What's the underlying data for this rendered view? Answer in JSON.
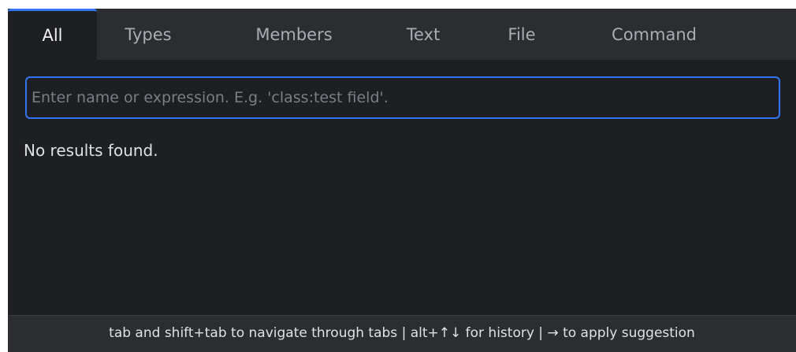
{
  "tabs": [
    {
      "label": "All",
      "active": true
    },
    {
      "label": "Types",
      "active": false
    },
    {
      "label": "Members",
      "active": false
    },
    {
      "label": "Text",
      "active": false
    },
    {
      "label": "File",
      "active": false
    },
    {
      "label": "Command",
      "active": false
    }
  ],
  "search": {
    "value": "",
    "placeholder": "Enter name or expression. E.g. 'class:test field'."
  },
  "results": {
    "empty_message": "No results found."
  },
  "footer": {
    "hint": "tab and shift+tab to navigate through tabs | alt+↑↓ for history | → to apply suggestion"
  },
  "colors": {
    "accent": "#3574f0",
    "background": "#1e1f22",
    "tabbar_background": "#2b2d30"
  }
}
